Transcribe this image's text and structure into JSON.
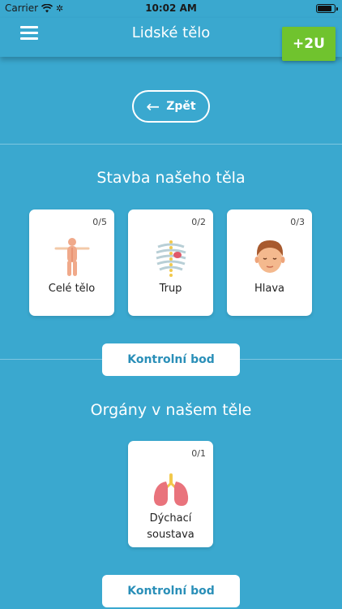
{
  "status_bar": {
    "carrier": "Carrier",
    "time": "10:02 AM",
    "battery_level": 0.9
  },
  "nav": {
    "title": "Lidské tělo",
    "logo_text": "+2U"
  },
  "back_button": {
    "label": "Zpět"
  },
  "sections": [
    {
      "title": "Stavba našeho těla",
      "cards": [
        {
          "label": "Celé tělo",
          "count": "0/5",
          "icon": "full-body-icon"
        },
        {
          "label": "Trup",
          "count": "0/2",
          "icon": "torso-icon"
        },
        {
          "label": "Hlava",
          "count": "0/3",
          "icon": "head-icon"
        }
      ],
      "checkpoint_label": "Kontrolní bod"
    },
    {
      "title": "Orgány v našem těle",
      "cards": [
        {
          "label": "Dýchací soustava",
          "count": "0/1",
          "icon": "lungs-icon"
        }
      ],
      "checkpoint_label": "Kontrolní bod"
    }
  ],
  "colors": {
    "background": "#3aa8cf",
    "logo_badge": "#70c32e",
    "button_text": "#2a8fb8"
  }
}
